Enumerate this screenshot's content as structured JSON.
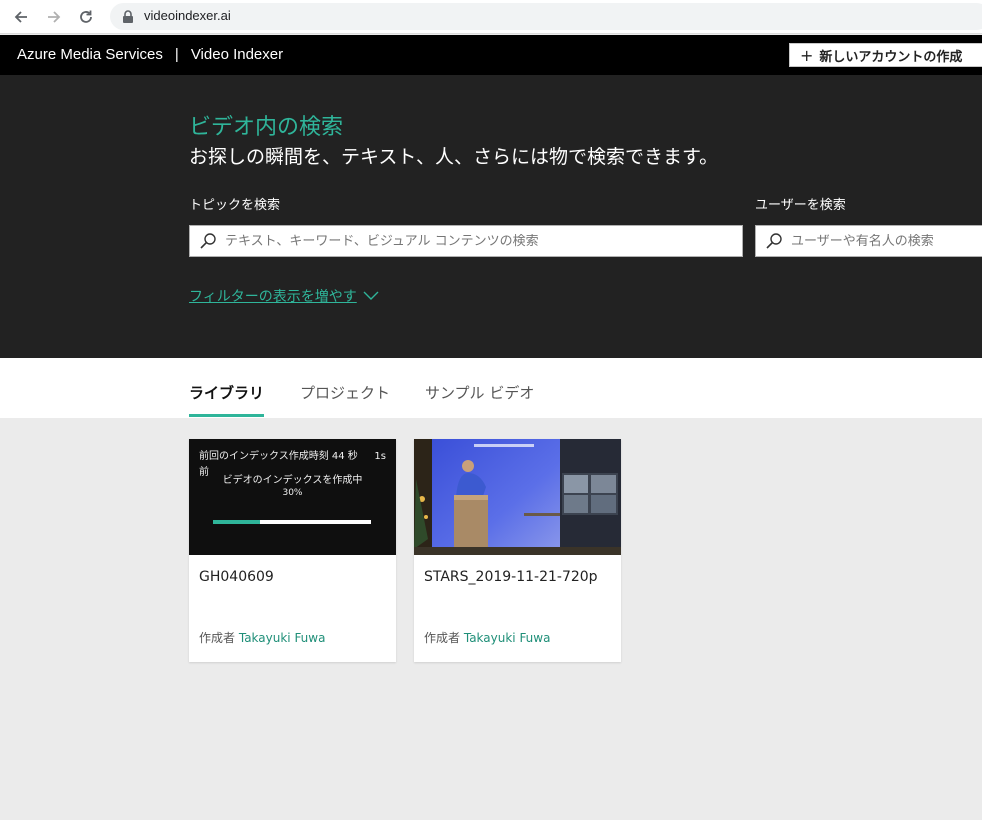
{
  "browser": {
    "url": "videoindexer.ai"
  },
  "header": {
    "brand_left": "Azure Media Services",
    "brand_sep": "|",
    "brand_right": "Video Indexer",
    "new_account_label": "新しいアカウントの作成",
    "new_account_icon": "plus-icon"
  },
  "hero": {
    "title": "ビデオ内の検索",
    "subtitle": "お探しの瞬間を、テキスト、人、さらには物で検索できます。",
    "topic_label": "トピックを検索",
    "topic_placeholder": "テキスト、キーワード、ビジュアル コンテンツの検索",
    "user_label": "ユーザーを検索",
    "user_placeholder": "ユーザーや有名人の検索",
    "filter_link": "フィルターの表示を増やす"
  },
  "tabs": [
    {
      "label": "ライブラリ",
      "active": true
    },
    {
      "label": "プロジェクト",
      "active": false
    },
    {
      "label": "サンプル ビデオ",
      "active": false
    }
  ],
  "cards": [
    {
      "title": "GH040609",
      "author_prefix": "作成者",
      "author": "Takayuki Fuwa",
      "indexing": {
        "time_text": "前回のインデックス作成時刻 44 秒前",
        "duration": "1s",
        "message": "ビデオのインデックスを作成中",
        "percent_text": "30%",
        "progress": 0.3
      }
    },
    {
      "title": "STARS_2019-11-21-720p",
      "author_prefix": "作成者",
      "author": "Takayuki Fuwa"
    }
  ],
  "colors": {
    "accent": "#2fb59a",
    "header_bg": "#000000",
    "hero_bg": "#222222",
    "page_bg": "#ebebeb"
  }
}
